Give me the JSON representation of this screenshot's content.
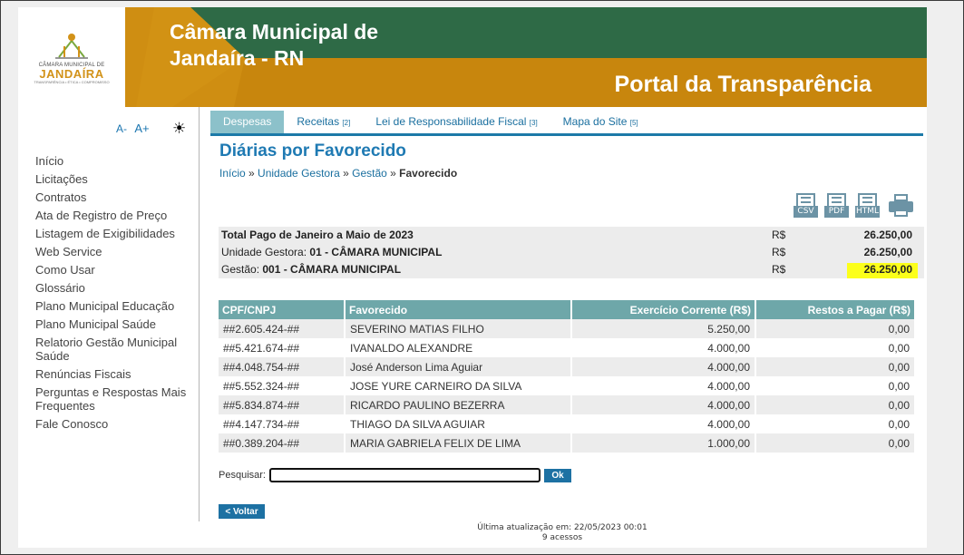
{
  "header": {
    "logo_text_top": "CÂMARA MUNICIPAL DE",
    "logo_text_main": "JANDAÍRA",
    "logo_text_bottom": "TRANSPARÊNCIA • ÉTICA • COMPROMISSO",
    "site_title": "Câmara Municipal de Jandaíra - RN",
    "portal_title": "Portal da Transparência",
    "colors": {
      "green": "#2e6a46",
      "gold": "#c8880e"
    }
  },
  "accessibility": {
    "font_decrease": "A-",
    "font_increase": "A+",
    "contrast_icon": "sun-icon"
  },
  "sidebar": {
    "items": [
      "Início",
      "Licitações",
      "Contratos",
      "Ata de Registro de Preço",
      "Listagem de Exigibilidades",
      "Web Service",
      "Como Usar",
      "Glossário",
      "Plano Municipal Educação",
      "Plano Municipal Saúde",
      "Relatorio Gestão Municipal Saúde",
      "Renúncias Fiscais",
      "Perguntas e Respostas Mais Frequentes",
      "Fale Conosco"
    ]
  },
  "tabs": [
    {
      "label": "Despesas",
      "count": ""
    },
    {
      "label": "Receitas",
      "count": "[2]"
    },
    {
      "label": "Lei de Responsabilidade Fiscal",
      "count": "[3]"
    },
    {
      "label": "Mapa do Site",
      "count": "[5]"
    }
  ],
  "page": {
    "title": "Diárias por Favorecido",
    "breadcrumb": {
      "home": "Início",
      "sep": " » ",
      "unit": "Unidade Gestora",
      "gestao": "Gestão",
      "current": "Favorecido"
    }
  },
  "exports": {
    "csv": "CSV",
    "pdf": "PDF",
    "html": "HTML",
    "print_icon": "printer-icon"
  },
  "summary": {
    "total_label": "Total Pago de Janeiro a Maio de 2023",
    "total_currency": "R$",
    "total_value": "26.250,00",
    "unit_label": "Unidade Gestora:",
    "unit_value_name": "01 - CÂMARA MUNICIPAL",
    "unit_currency": "R$",
    "unit_value": "26.250,00",
    "gestao_label": "Gestão:",
    "gestao_value_name": "001 - CÂMARA MUNICIPAL",
    "gestao_currency": "R$",
    "gestao_value": "26.250,00",
    "highlight_color": "#fcff1a"
  },
  "table": {
    "headers": [
      "CPF/CNPJ",
      "Favorecido",
      "Exercício Corrente (R$)",
      "Restos a Pagar (R$)"
    ],
    "rows": [
      [
        "##2.605.424-##",
        "SEVERINO MATIAS FILHO",
        "5.250,00",
        "0,00"
      ],
      [
        "##5.421.674-##",
        "IVANALDO ALEXANDRE",
        "4.000,00",
        "0,00"
      ],
      [
        "##4.048.754-##",
        "José Anderson Lima Aguiar",
        "4.000,00",
        "0,00"
      ],
      [
        "##5.552.324-##",
        "JOSE YURE CARNEIRO DA SILVA",
        "4.000,00",
        "0,00"
      ],
      [
        "##5.834.874-##",
        "RICARDO PAULINO BEZERRA",
        "4.000,00",
        "0,00"
      ],
      [
        "##4.147.734-##",
        "THIAGO DA SILVA AGUIAR",
        "4.000,00",
        "0,00"
      ],
      [
        "##0.389.204-##",
        "MARIA GABRIELA FELIX DE LIMA",
        "1.000,00",
        "0,00"
      ]
    ]
  },
  "search": {
    "label": "Pesquisar:",
    "value": "",
    "button": "Ok"
  },
  "back_button": "< Voltar",
  "footer": {
    "updated": "Última atualização em: 22/05/2023 00:01",
    "visits": "9 acessos"
  }
}
